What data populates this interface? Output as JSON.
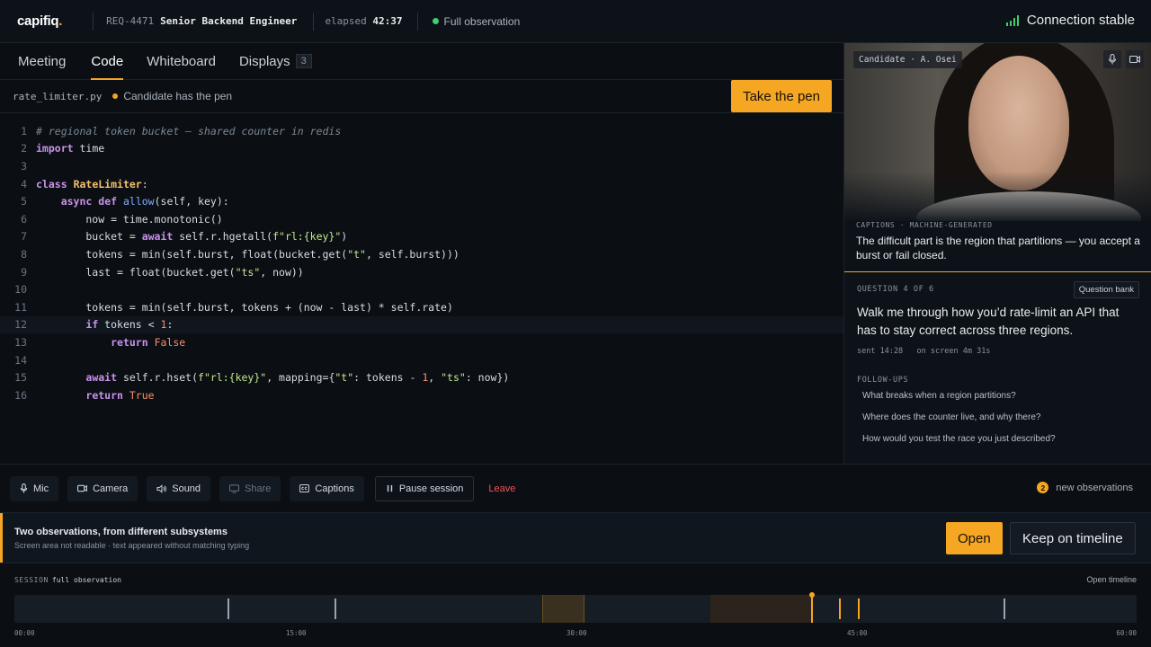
{
  "topbar": {
    "logo": "capifiq",
    "logo_dot": ".",
    "req_id": "REQ-4471",
    "role": "Senior Backend Engineer",
    "elapsed_label": "elapsed",
    "elapsed_value": "42:37",
    "observation_status": "Full observation",
    "connection": "Connection stable"
  },
  "tabs": [
    {
      "label": "Meeting"
    },
    {
      "label": "Code",
      "active": true
    },
    {
      "label": "Whiteboard"
    },
    {
      "label": "Displays",
      "badge": "3"
    }
  ],
  "editor": {
    "filename": "rate_limiter.py",
    "pen_status": "Candidate has the pen",
    "take_pen_label": "Take the pen",
    "highlighted_line": 12,
    "lines": [
      {
        "n": "1",
        "code": "# regional token bucket — shared counter in redis"
      },
      {
        "n": "2",
        "code": "import time"
      },
      {
        "n": "3",
        "code": ""
      },
      {
        "n": "4",
        "code": "class RateLimiter:"
      },
      {
        "n": "5",
        "code": "    async def allow(self, key):"
      },
      {
        "n": "6",
        "code": "        now = time.monotonic()"
      },
      {
        "n": "7",
        "code": "        bucket = await self.r.hgetall(f\"rl:{key}\")"
      },
      {
        "n": "8",
        "code": "        tokens = min(self.burst, float(bucket.get(\"t\", self.burst)))"
      },
      {
        "n": "9",
        "code": "        last = float(bucket.get(\"ts\", now))"
      },
      {
        "n": "10",
        "code": ""
      },
      {
        "n": "11",
        "code": "        tokens = min(self.burst, tokens + (now - last) * self.rate)"
      },
      {
        "n": "12",
        "code": "        if tokens < 1:"
      },
      {
        "n": "13",
        "code": "            return False"
      },
      {
        "n": "14",
        "code": ""
      },
      {
        "n": "15",
        "code": "        await self.r.hset(f\"rl:{key}\", mapping={\"t\": tokens - 1, \"ts\": now})"
      },
      {
        "n": "16",
        "code": "        return True"
      }
    ]
  },
  "video": {
    "candidate_tag": "Candidate · A. Osei",
    "mic_icon": "mic-icon",
    "camera_icon": "camera-icon"
  },
  "captions": {
    "label": "CAPTIONS · MACHINE-GENERATED",
    "text": "The difficult part is the region that partitions — you accept a burst or fail closed."
  },
  "question": {
    "number": "QUESTION 4 OF 6",
    "bank_label": "Question bank",
    "text": "Walk me through how you’d rate-limit an API that has to stay correct across three regions.",
    "sent": "sent 14:28",
    "on_screen": "on screen 4m 31s",
    "followups_label": "FOLLOW-UPS",
    "followups": [
      "What breaks when a region partitions?",
      "Where does the counter live, and why there?",
      "How would you test the race you just described?"
    ]
  },
  "controls": {
    "mic": "Mic",
    "camera": "Camera",
    "sound": "Sound",
    "share": "Share",
    "captions": "Captions",
    "pause": "Pause session",
    "leave": "Leave",
    "new_obs_count": "2",
    "new_obs_label": "new observations"
  },
  "alert": {
    "title": "Two observations, from different subsystems",
    "subtitle": "Screen area not readable · text appeared without matching typing",
    "open_label": "Open",
    "keep_label": "Keep on timeline"
  },
  "timeline": {
    "label": "SESSION",
    "mode": "full observation",
    "open_label": "Open timeline",
    "duration_min": 60,
    "position_min": 42.6,
    "ticks": [
      "00:00",
      "15:00",
      "30:00",
      "45:00",
      "60:00"
    ],
    "segments": [
      {
        "start_min": 28.2,
        "end_min": 30.5,
        "color": "#3a3020"
      },
      {
        "start_min": 37.2,
        "end_min": 42.6,
        "color": "#2c241c"
      }
    ],
    "markers": [
      {
        "at_min": 11.4,
        "color": "#9aa3ad"
      },
      {
        "at_min": 17.1,
        "color": "#9aa3ad"
      },
      {
        "at_min": 44.1,
        "color": "#f5a623"
      },
      {
        "at_min": 45.1,
        "color": "#f5a623"
      },
      {
        "at_min": 52.9,
        "color": "#9aa3ad"
      }
    ]
  },
  "colors": {
    "accent": "#f5a623",
    "ok": "#3ecf6e",
    "danger": "#ef5350"
  }
}
